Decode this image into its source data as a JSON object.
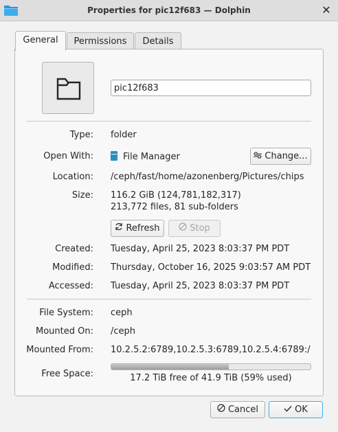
{
  "window": {
    "title": "Properties for pic12f683 — Dolphin",
    "app_icon": "folder-icon",
    "close_label": "✕"
  },
  "tabs": [
    {
      "label": "General",
      "active": true
    },
    {
      "label": "Permissions",
      "active": false
    },
    {
      "label": "Details",
      "active": false
    }
  ],
  "header": {
    "icon": "folder-icon",
    "name": "pic12f683"
  },
  "fields": {
    "type": {
      "label": "Type:",
      "value": "folder"
    },
    "open_with": {
      "label": "Open With:",
      "value": "File Manager",
      "icon": "file-manager-icon",
      "button_label": "Change..."
    },
    "location": {
      "label": "Location:",
      "value": "/ceph/fast/home/azonenberg/Pictures/chips"
    },
    "size": {
      "label": "Size:",
      "value": "116.2 GiB (124,781,182,317)",
      "detail": "213,772 files, 81 sub-folders"
    },
    "refresh_label": "Refresh",
    "stop_label": "Stop",
    "created": {
      "label": "Created:",
      "value": "Tuesday, April 25, 2023 8:03:37 PM PDT"
    },
    "modified": {
      "label": "Modified:",
      "value": "Thursday, October 16, 2025 9:03:57 AM PDT"
    },
    "accessed": {
      "label": "Accessed:",
      "value": "Tuesday, April 25, 2023 8:03:37 PM PDT"
    },
    "file_system": {
      "label": "File System:",
      "value": "ceph"
    },
    "mounted_on": {
      "label": "Mounted On:",
      "value": "/ceph"
    },
    "mounted_from": {
      "label": "Mounted From:",
      "value": "10.2.5.2:6789,10.2.5.3:6789,10.2.5.4:6789:/"
    },
    "free_space": {
      "label": "Free Space:",
      "text": "17.2 TiB free of 41.9 TiB (59% used)",
      "used_fraction": 0.59
    }
  },
  "buttons": {
    "cancel": "Cancel",
    "ok": "OK"
  },
  "colors": {
    "accent": "#3daee9",
    "folder_blue": "#2a8fbd"
  }
}
